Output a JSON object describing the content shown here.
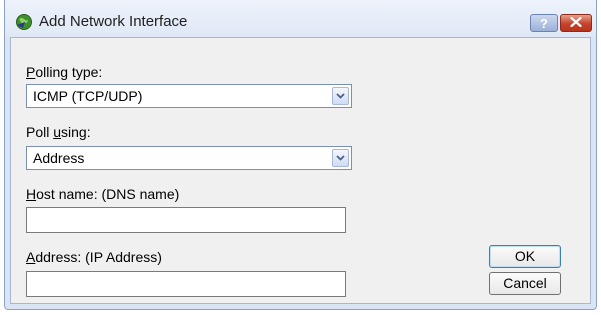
{
  "window": {
    "title": "Add Network Interface",
    "help_label": "?"
  },
  "form": {
    "polling_type": {
      "label_mnemonic": "P",
      "label_rest": "olling type:",
      "value": "ICMP (TCP/UDP)"
    },
    "poll_using": {
      "label_prefix": "Poll ",
      "label_mnemonic": "u",
      "label_rest": "sing:",
      "value": "Address"
    },
    "host_name": {
      "label_mnemonic": "H",
      "label_rest": "ost name: (DNS name)",
      "value": ""
    },
    "address": {
      "label_mnemonic": "A",
      "label_rest": "ddress: (IP Address)",
      "value": ""
    }
  },
  "buttons": {
    "ok": "OK",
    "cancel": "Cancel"
  },
  "colors": {
    "client_bg": "#f0f0f0",
    "close_button": "#c4422b",
    "title_bar": "#dfe8f6"
  }
}
